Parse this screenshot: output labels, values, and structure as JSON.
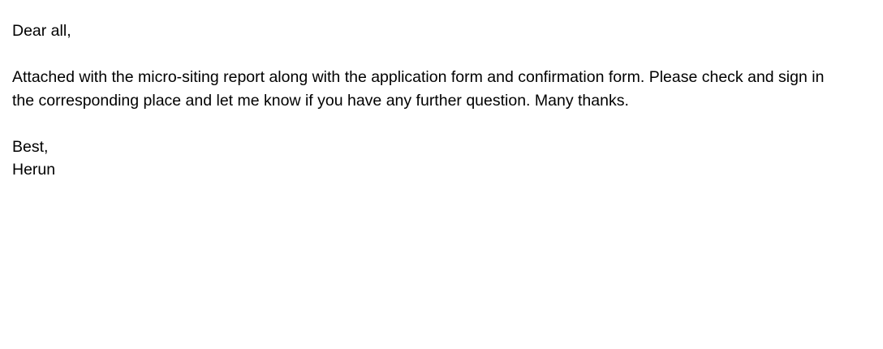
{
  "email": {
    "greeting": "Dear all,",
    "body_line_1": "Attached with the micro-siting report along with the application form and confirmation form. Please check and sign in",
    "body_line_2": "the corresponding place and let me know if you have any further question. Many thanks.",
    "closing": "Best,",
    "signature": "Herun"
  }
}
